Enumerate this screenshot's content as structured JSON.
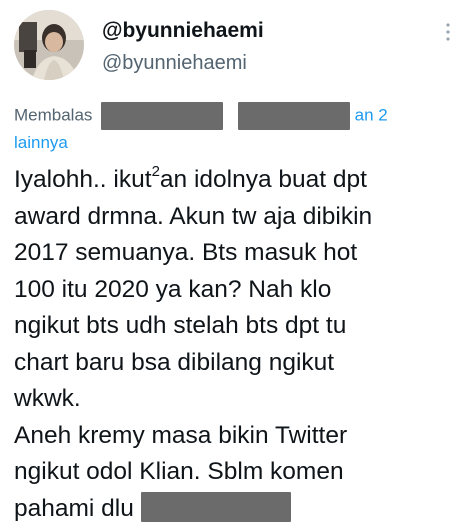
{
  "user": {
    "display_name": "@byunniehaemi",
    "handle": "@byunniehaemi"
  },
  "reply": {
    "prefix": "Membalas",
    "suffix_visible": "an 2",
    "line2": "lainnya"
  },
  "body": {
    "lines": [
      "Iyalohh.. ikut",
      "award drmna. Akun tw aja dibikin",
      "2017 semuanya. Bts masuk hot",
      "100 itu 2020 ya kan? Nah klo",
      "ngikut bts udh stelah bts dpt tu",
      "chart baru bsa dibilang ngikut",
      "wkwk.",
      "Aneh kremy masa bikin Twitter",
      "ngikut odol Klian. Sblm komen",
      "pahami dlu"
    ],
    "sup": "2",
    "line1_rest": "an idolnya buat dpt"
  },
  "colors": {
    "text": "#0f1419",
    "secondary": "#536471",
    "link": "#1d9bf0",
    "redaction": "#6b6b6b"
  },
  "icons": {
    "more": "more-vertical-icon"
  }
}
